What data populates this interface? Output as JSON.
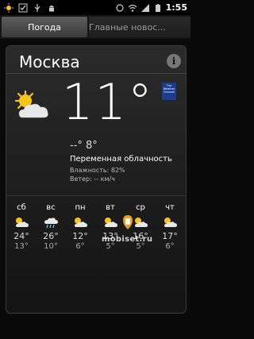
{
  "status": {
    "time": "1:55"
  },
  "tabs": {
    "active": "Погода",
    "inactive": "Главные новос..."
  },
  "city": "Москва",
  "info_label": "i",
  "current": {
    "temp": "11°",
    "hi_lo": "--°  8°",
    "description": "Переменная облачность",
    "humidity": "Влажность: 82%",
    "wind": "Ветер: -- км/ч"
  },
  "logo_text": "The Weather Channel",
  "forecast": [
    {
      "day": "сб",
      "hi": "24°",
      "lo": "13°",
      "icon": "partly-cloudy-icon"
    },
    {
      "day": "вс",
      "hi": "26°",
      "lo": "10°",
      "icon": "rain-cloud-icon"
    },
    {
      "day": "пн",
      "hi": "12°",
      "lo": "6°",
      "icon": "partly-cloudy-icon"
    },
    {
      "day": "вт",
      "hi": "13°",
      "lo": "5°",
      "icon": "partly-cloudy-icon"
    },
    {
      "day": "ср",
      "hi": "16°",
      "lo": "5°",
      "icon": "partly-cloudy-icon"
    },
    {
      "day": "чт",
      "hi": "17°",
      "lo": "6°",
      "icon": "partly-cloudy-icon"
    }
  ],
  "watermark": "mobiset.ru",
  "colors": {
    "sun": "#f5c518",
    "cloud": "#e8e8e8",
    "rain": "#7ec8f0",
    "accent": "#f39c12"
  }
}
